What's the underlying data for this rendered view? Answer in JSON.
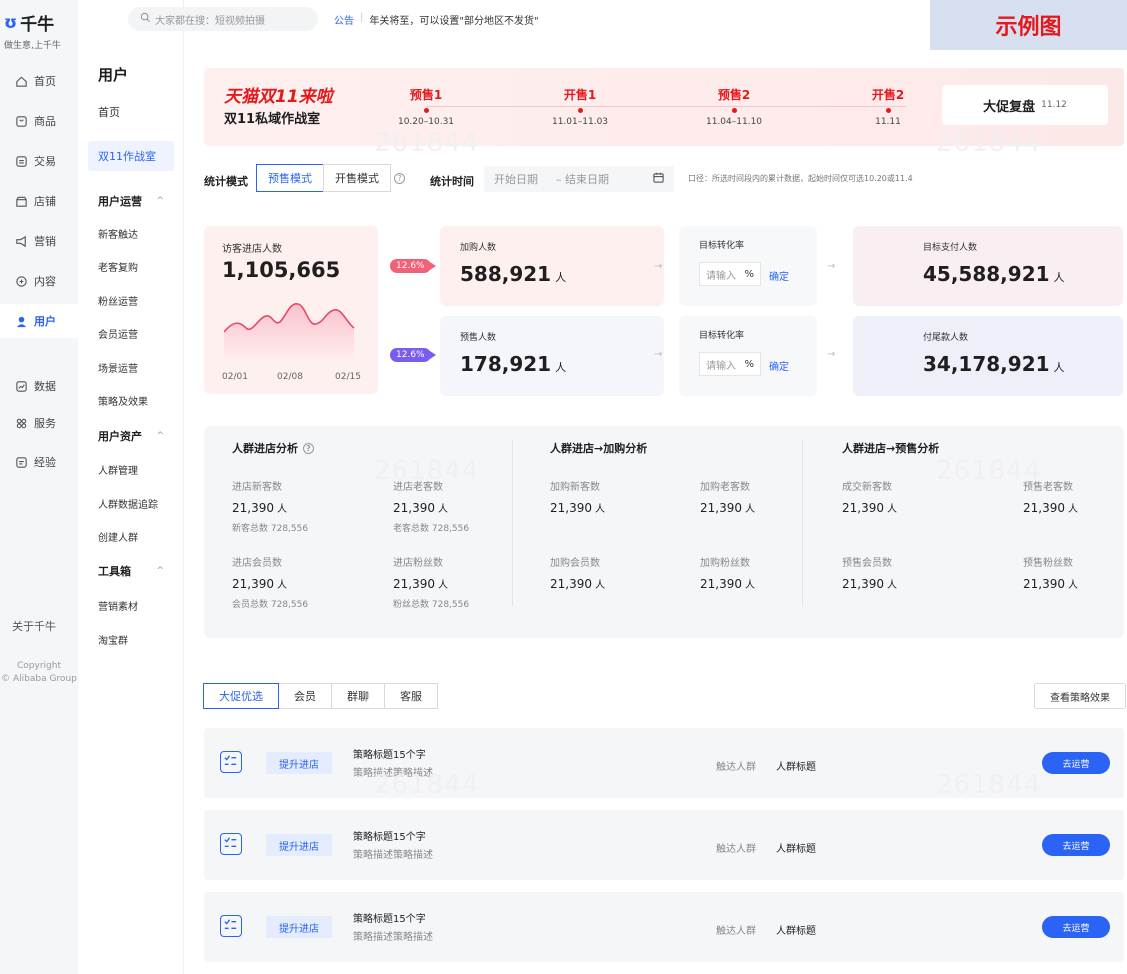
{
  "brand": {
    "name": "千牛",
    "slogan": "做生意,上千牛"
  },
  "rail": {
    "items": [
      {
        "label": "首页",
        "icon": "home-icon"
      },
      {
        "label": "商品",
        "icon": "goods-icon"
      },
      {
        "label": "交易",
        "icon": "trade-icon"
      },
      {
        "label": "店铺",
        "icon": "store-icon"
      },
      {
        "label": "营销",
        "icon": "marketing-icon"
      },
      {
        "label": "内容",
        "icon": "content-icon"
      },
      {
        "label": "用户",
        "icon": "user-icon"
      },
      {
        "label": "数据",
        "icon": "data-icon"
      },
      {
        "label": "服务",
        "icon": "service-icon"
      },
      {
        "label": "经验",
        "icon": "experience-icon"
      }
    ],
    "about": "关于千牛",
    "copyright": "Copyright",
    "copyright_owner": "© Alibaba Group"
  },
  "nav2": {
    "title": "用户",
    "home": "首页",
    "campaign": "双11作战室",
    "groups": [
      {
        "label": "用户运营",
        "items": [
          "新客触达",
          "老客复购",
          "粉丝运营",
          "会员运营",
          "场景运营",
          "策略及效果"
        ]
      },
      {
        "label": "用户资产",
        "items": [
          "人群管理",
          "人群数据追踪",
          "创建人群"
        ]
      },
      {
        "label": "工具箱",
        "items": [
          "营销素材",
          "淘宝群"
        ]
      }
    ]
  },
  "topbar": {
    "search_placeholder": "大家都在搜：短视频拍摄",
    "notice_label": "公告",
    "notice_text": "年关将至，可以设置\"部分地区不发货\"",
    "sample_badge": "示例图"
  },
  "banner": {
    "brand": "天猫双11来啦",
    "subtitle": "双11私域作战室",
    "phases": [
      {
        "name": "预售1",
        "date": "10.20–10.31"
      },
      {
        "name": "开售1",
        "date": "11.01–11.03"
      },
      {
        "name": "预售2",
        "date": "11.04–11.10"
      },
      {
        "name": "开售2",
        "date": "11.11"
      }
    ],
    "review_title": "大促复盘",
    "review_date": "11.12"
  },
  "filters": {
    "mode_label": "统计模式",
    "modes": [
      "预售模式",
      "开售模式"
    ],
    "time_label": "统计时间",
    "start_placeholder": "开始日期",
    "end_placeholder": "– 结束日期",
    "note": "口径：所选时间段内的累计数据，起始时间仅可选10.20或11.4"
  },
  "funnel": {
    "visitors_label": "访客进店人数",
    "visitors_value": "1,105,665",
    "chart_dates": [
      "02/01",
      "02/08",
      "02/15"
    ],
    "rate_top": "12.6%",
    "rate_bottom": "12.6%",
    "cart_label": "加购人数",
    "cart_value": "588,921",
    "presale_label": "预售人数",
    "presale_value": "178,921",
    "unit": "人",
    "conv_label": "目标转化率",
    "conv_placeholder": "请输入",
    "conv_unit": "%",
    "conv_ok": "确定",
    "target_pay_label": "目标支付人数",
    "target_pay_value": "45,588,921",
    "final_pay_label": "付尾款人数",
    "final_pay_value": "34,178,921"
  },
  "analysis": {
    "sections": [
      {
        "title": "人群进店分析",
        "stats": [
          {
            "label": "进店新客数",
            "value": "21,390",
            "total": "新客总数 728,556"
          },
          {
            "label": "进店老客数",
            "value": "21,390",
            "total": "老客总数 728,556"
          },
          {
            "label": "进店会员数",
            "value": "21,390",
            "total": "会员总数 728,556"
          },
          {
            "label": "进店粉丝数",
            "value": "21,390",
            "total": "粉丝总数 728,556"
          }
        ]
      },
      {
        "title": "人群进店→加购分析",
        "stats": [
          {
            "label": "加购新客数",
            "value": "21,390"
          },
          {
            "label": "加购老客数",
            "value": "21,390"
          },
          {
            "label": "加购会员数",
            "value": "21,390"
          },
          {
            "label": "加购粉丝数",
            "value": "21,390"
          }
        ]
      },
      {
        "title": "人群进店→预售分析",
        "stats": [
          {
            "label": "成交新客数",
            "value": "21,390"
          },
          {
            "label": "预售老客数",
            "value": "21,390"
          },
          {
            "label": "预售会员数",
            "value": "21,390"
          },
          {
            "label": "预售粉丝数",
            "value": "21,390"
          }
        ]
      }
    ],
    "unit": "人"
  },
  "strategy": {
    "tabs": [
      "大促优选",
      "会员",
      "群聊",
      "客服"
    ],
    "view_button": "查看策略效果",
    "rows": [
      {
        "tag": "提升进店",
        "title": "策略标题15个字",
        "desc": "策略描述策略描述",
        "reach_label": "触达人群",
        "reach_value": "人群标题",
        "action": "去运营"
      },
      {
        "tag": "提升进店",
        "title": "策略标题15个字",
        "desc": "策略描述策略描述",
        "reach_label": "触达人群",
        "reach_value": "人群标题",
        "action": "去运营"
      },
      {
        "tag": "提升进店",
        "title": "策略标题15个字",
        "desc": "策略描述策略描述",
        "reach_label": "触达人群",
        "reach_value": "人群标题",
        "action": "去运营"
      }
    ]
  },
  "watermark": "261844",
  "colors": {
    "accent": "#2a63f5",
    "promo_red": "#e5181c",
    "pill_red": "#f0617a",
    "pill_purple": "#7a5cf0"
  }
}
